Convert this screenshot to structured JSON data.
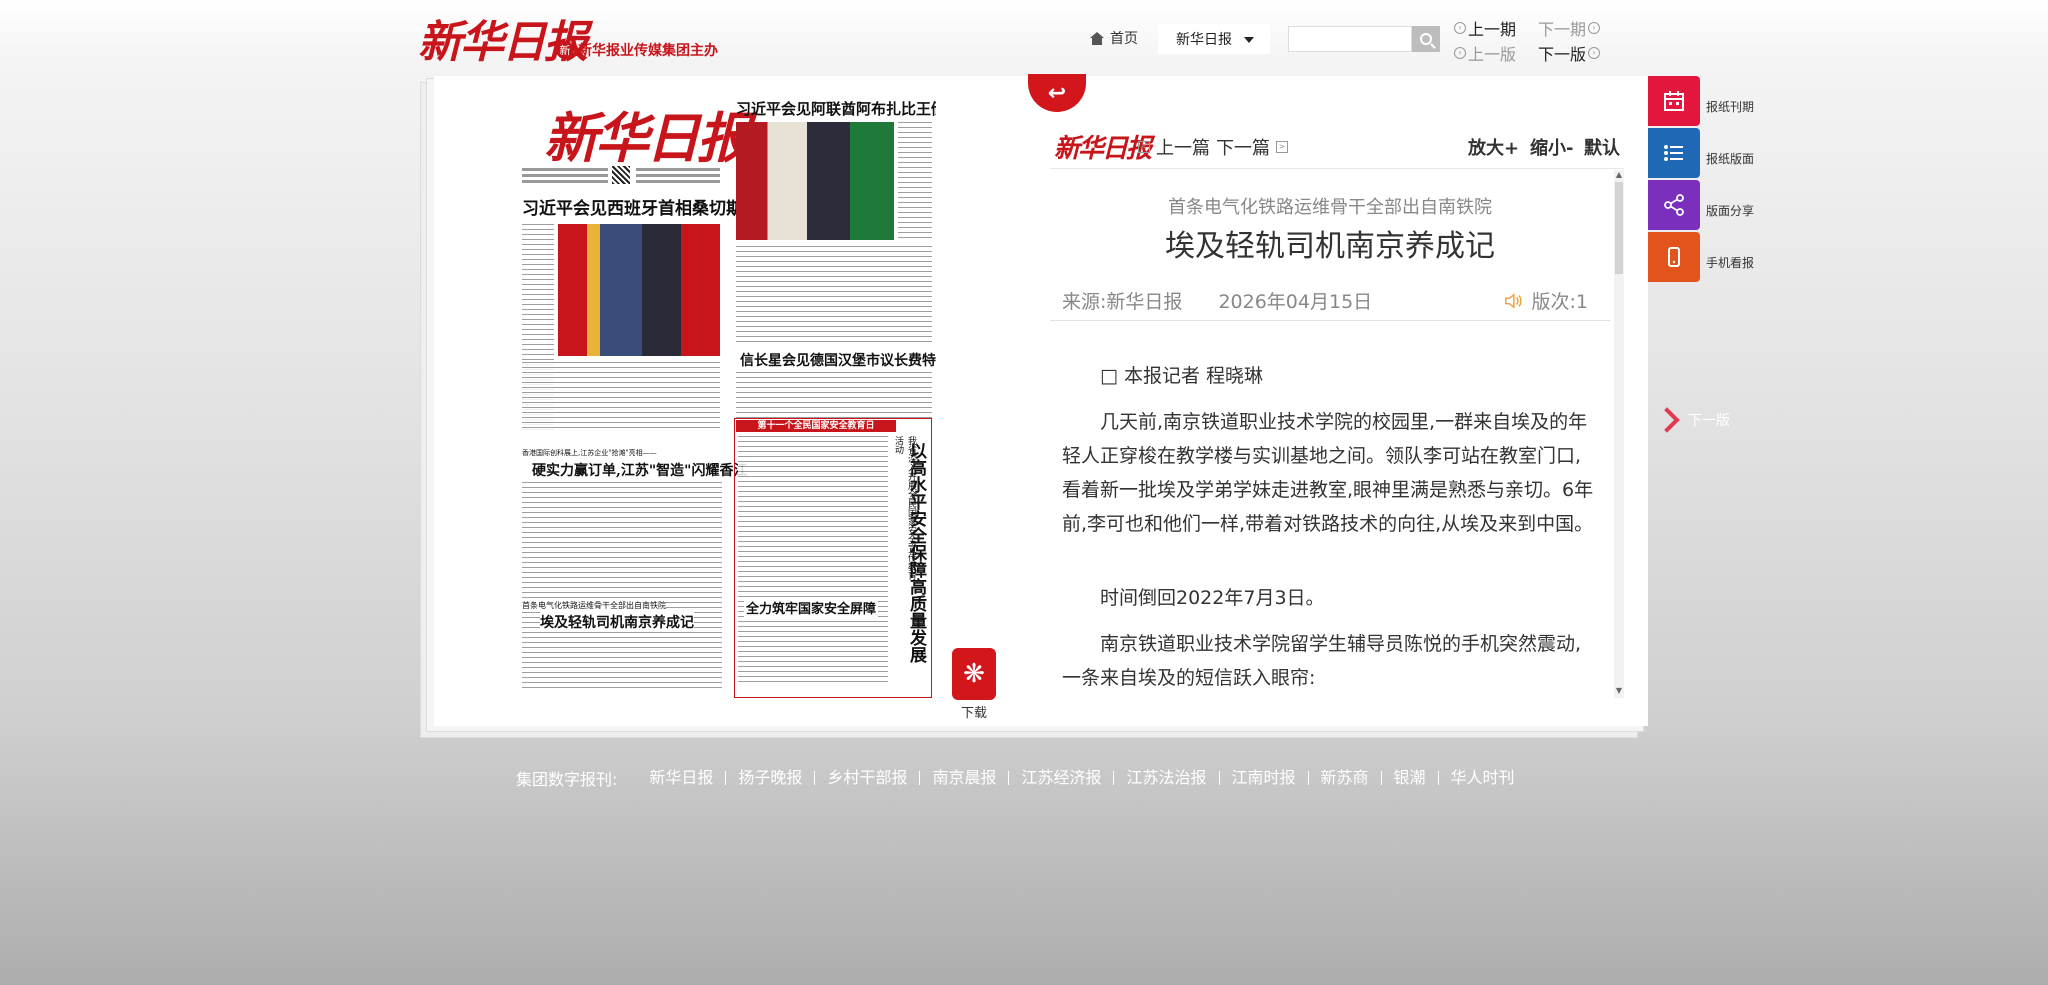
{
  "header": {
    "logo": "新华日报",
    "sponsor": "新华报业传媒集团主办",
    "home_label": "首页",
    "paper_select": "新华日报",
    "search_placeholder": "",
    "prev_issue": "上一期",
    "next_issue": "下一期",
    "prev_edition": "上一版",
    "next_edition": "下一版"
  },
  "newspaper": {
    "logo": "新华日报",
    "headline_1": "习近平会见西班牙首相桑切斯",
    "headline_2": "习近平会见阿联酋阿布扎比王储哈立德",
    "headline_3": "信长星会见德国汉堡市议长费特",
    "kicker_4": "香港国际创科展上,江苏企业\"抢滩\"亮相——",
    "headline_4": "硬实力赢订单,江苏\"智造\"闪耀香江",
    "kicker_5": "首条电气化铁路运维骨干全部出自南铁院",
    "headline_5": "埃及轻轨司机南京养成记",
    "banner_6": "第十一个全民国家安全教育日",
    "headline_6": "以高水平安全保障高质量发展",
    "vert_6": "我省深入开展全民国家安全宣传教育活动",
    "headline_7": "全力筑牢国家安全屏障",
    "download_label": "下载"
  },
  "article": {
    "logo": "新华日报",
    "prev": "上一篇",
    "next": "下一篇",
    "zoom_in": "放大+",
    "zoom_out": "缩小-",
    "default": "默认",
    "subhead": "首条电气化铁路运维骨干全部出自南铁院",
    "title": "埃及轻轨司机南京养成记",
    "source": "来源:新华日报",
    "date": "2026年04月15日",
    "edition": "版次:1",
    "byline": "□ 本报记者 程晓琳",
    "paragraphs": [
      "几天前,南京铁道职业技术学院的校园里,一群来自埃及的年轻人正穿梭在教学楼与实训基地之间。领队李可站在教室门口,看着新一批埃及学弟学妹走进教室,眼神里满是熟悉与亲切。6年前,李可也和他们一样,带着对铁路技术的向往,从埃及来到中国。",
      "时间倒回2022年7月3日。",
      "南京铁道职业技术学院留学生辅导员陈悦的手机突然震动,一条来自埃及的短信跃入眼帘:"
    ]
  },
  "side_tabs": {
    "items": [
      {
        "label": "报纸刊期",
        "icon": "calendar-icon",
        "color": "#e3173d"
      },
      {
        "label": "报纸版面",
        "icon": "list-icon",
        "color": "#1f68b5"
      },
      {
        "label": "版面分享",
        "icon": "share-icon",
        "color": "#7b2fbd"
      },
      {
        "label": "手机看报",
        "icon": "phone-icon",
        "color": "#e1541c"
      }
    ],
    "next_edition": "下一版"
  },
  "footer": {
    "label": "集团数字报刊:",
    "links": [
      "新华日报",
      "扬子晚报",
      "乡村干部报",
      "南京晨报",
      "江苏经济报",
      "江苏法治报",
      "江南时报",
      "新苏商",
      "银潮",
      "华人时刊"
    ]
  }
}
